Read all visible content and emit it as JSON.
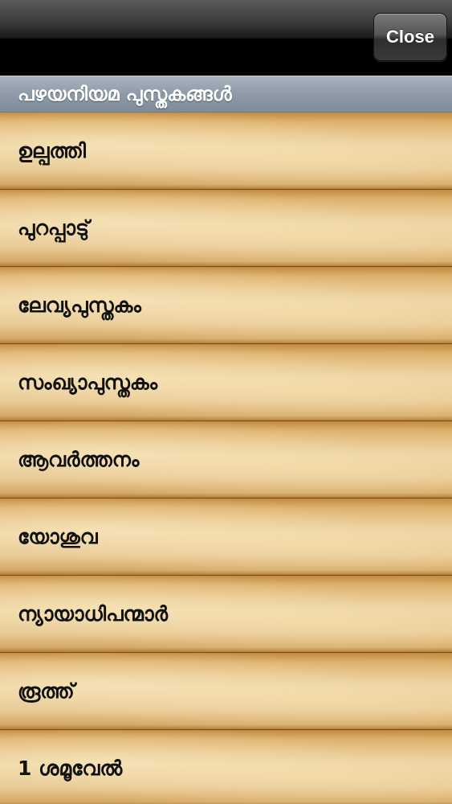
{
  "toolbar": {
    "close_label": "Close"
  },
  "section": {
    "title": "പഴയനിയമ പുസ്തകങ്ങൾ"
  },
  "books": [
    {
      "label": "ഉല്പത്തി"
    },
    {
      "label": "പുറപ്പാടു്"
    },
    {
      "label": "ലേവ്യപുസ്തകം"
    },
    {
      "label": "സംഖ്യാപുസ്തകം"
    },
    {
      "label": "ആവർത്തനം"
    },
    {
      "label": "യോശുവ"
    },
    {
      "label": "ന്യായാധിപന്മാർ"
    },
    {
      "label": "രൂത്ത്"
    },
    {
      "label": "1 ശമൂവേൽ"
    }
  ],
  "colors": {
    "header_bar": "#000000",
    "section_header": "#8e9aa8",
    "parchment": "#e6c68f",
    "text": "#111111"
  }
}
